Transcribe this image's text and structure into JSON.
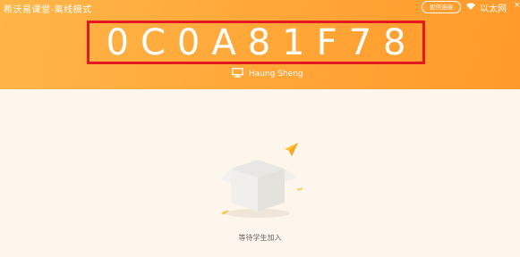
{
  "header": {
    "app_title": "希沃易课堂-离线模式",
    "connect_help_label": "如何连接",
    "network_label": "以太网",
    "close_glyph": "×"
  },
  "classroom": {
    "class_code": "0C0A81F78",
    "teacher_name": "Haung Sheng"
  },
  "status": {
    "waiting_text": "等待学生加入"
  },
  "icons": {
    "wifi": "wifi-icon",
    "monitor": "monitor-icon",
    "close": "close-icon"
  },
  "colors": {
    "header_orange": "#ffa637",
    "highlight_red": "#e4181f",
    "background": "#fdf6ec"
  }
}
